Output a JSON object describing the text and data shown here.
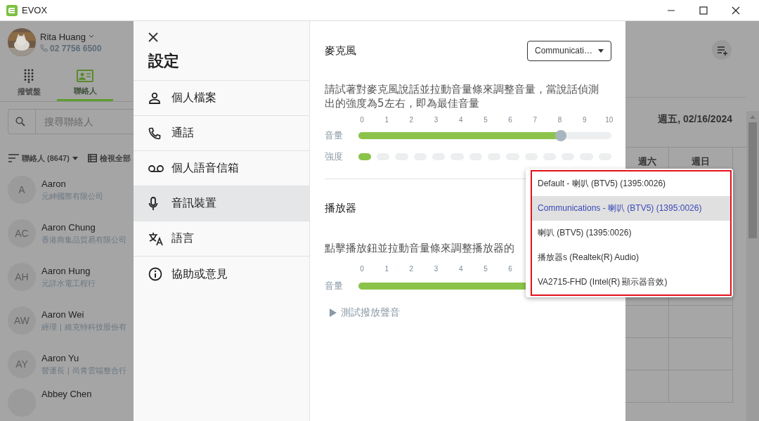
{
  "window": {
    "title": "EVOX"
  },
  "user": {
    "name": "Rita Huang",
    "phone": "02 7756 6500"
  },
  "nav_tabs": [
    {
      "label": "撥號盤",
      "selected": false
    },
    {
      "label": "聯絡人",
      "selected": true
    }
  ],
  "search": {
    "placeholder": "搜尋聯絡人"
  },
  "contact_filter": {
    "label": "聯絡人 (8647)",
    "view_all": "檢視全部"
  },
  "contacts": [
    {
      "initials": "A",
      "name": "Aaron",
      "company": "元紳國際有限公司"
    },
    {
      "initials": "AC",
      "name": "Aaron Chung",
      "company": "香港商集品貿易有限公司"
    },
    {
      "initials": "AH",
      "name": "Aaron Hung",
      "company": "元詳水電工程行"
    },
    {
      "initials": "AW",
      "name": "Aaron Wei",
      "company": "經理 | 維克特科技股份有"
    },
    {
      "initials": "AY",
      "name": "Aaron Yu",
      "company": "營運長 | 尚青雲端整合行"
    },
    {
      "name": "Abbey Chen"
    }
  ],
  "settings": {
    "title": "設定",
    "menu": [
      {
        "label": "個人檔案",
        "selected": false
      },
      {
        "label": "通話",
        "selected": false
      },
      {
        "label": "個人語音信箱",
        "selected": false
      },
      {
        "label": "音訊裝置",
        "selected": true
      },
      {
        "label": "語言",
        "selected": false
      },
      {
        "label": "協助或意見",
        "selected": false
      }
    ]
  },
  "microphone": {
    "title": "麥克風",
    "device": "Communicati…",
    "instructions": "請試著對麥克風說話並拉動音量條來調整音量，當說話偵測出的強度為5左右，即為最佳音量",
    "volume_label": "音量",
    "ticks": [
      "0",
      "1",
      "2",
      "3",
      "4",
      "5",
      "6",
      "7",
      "8",
      "9",
      "10"
    ],
    "volume": {
      "level": 0.8
    },
    "strength_label": "強度",
    "strength": {
      "level": 0.05
    }
  },
  "playback": {
    "title": "播放器",
    "instructions": "點擊播放鈕並拉動音量條來調整播放器的",
    "volume_label": "音量",
    "ticks": [
      "0",
      "1",
      "2",
      "3",
      "4",
      "5",
      "6"
    ],
    "volume": {
      "level": 0.8
    },
    "test_button": "測試撥放聲音"
  },
  "device_menu": [
    {
      "label": "Default - 喇叭 (BTV5) (1395:0026)",
      "selected": false
    },
    {
      "label": "Communications - 喇叭 (BTV5) (1395:0026)",
      "selected": true
    },
    {
      "label": "喇叭 (BTV5) (1395:0026)",
      "selected": false
    },
    {
      "label": "播放器s (Realtek(R) Audio)",
      "selected": false
    },
    {
      "label": "VA2715-FHD (Intel(R) 顯示器音效)",
      "selected": false
    }
  ],
  "calendar": {
    "date": "週五, 02/16/2024",
    "days": [
      "週六",
      "週日"
    ]
  }
}
